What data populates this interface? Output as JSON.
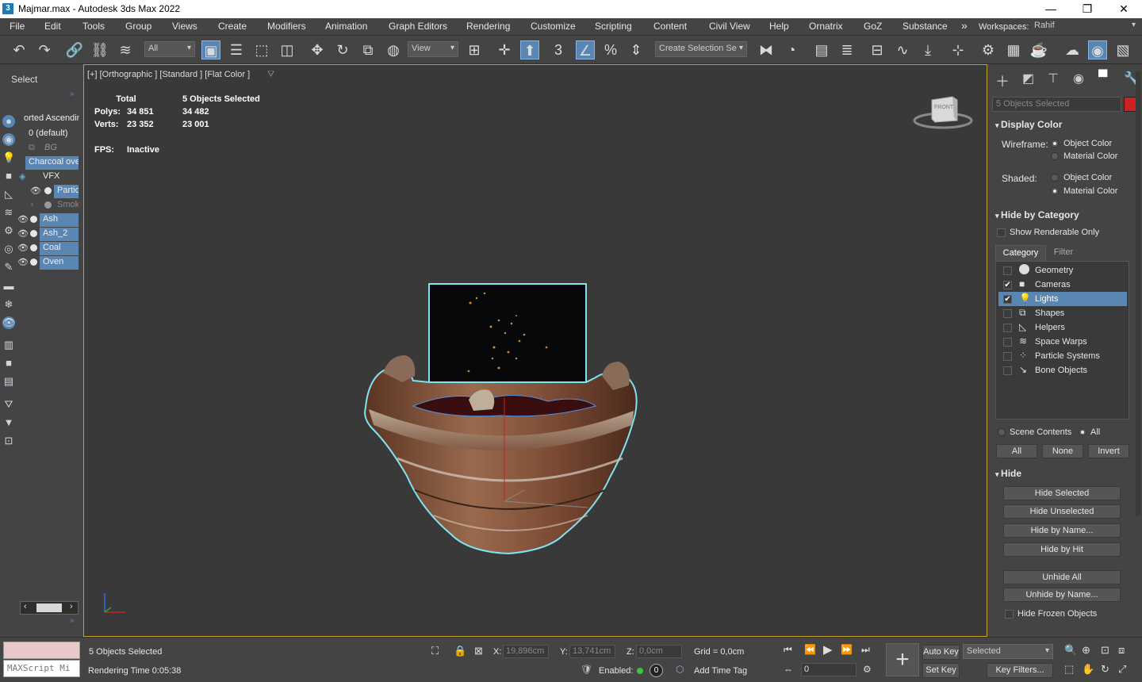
{
  "window": {
    "title": "Majmar.max - Autodesk 3ds Max 2022",
    "app_icon": "3"
  },
  "menubar": {
    "items": [
      "File",
      "Edit",
      "Tools",
      "Group",
      "Views",
      "Create",
      "Modifiers",
      "Animation",
      "Graph Editors",
      "Rendering",
      "Customize",
      "Scripting",
      "Content",
      "Civil View",
      "Help",
      "Ornatrix",
      "GoZ",
      "Substance"
    ],
    "workspaces_label": "Workspaces:",
    "workspace": "Rahif",
    "overflow": "»"
  },
  "toolbar": {
    "filter": "All",
    "ref_coord": "View",
    "selection_set": "Create Selection Se"
  },
  "scene_explorer": {
    "mode_label": "Select",
    "sort_label": "orted Ascendin",
    "items": [
      {
        "name": "0 (default)",
        "selected": false
      },
      {
        "name": "BG",
        "selected": false
      },
      {
        "name": "Charcoal ove",
        "selected": true
      },
      {
        "name": "VFX",
        "selected": false
      },
      {
        "name": "Partic",
        "selected": true
      },
      {
        "name": "Smoke",
        "selected": false
      },
      {
        "name": "Ash",
        "selected": true
      },
      {
        "name": "Ash_2",
        "selected": true
      },
      {
        "name": "Coal",
        "selected": true
      },
      {
        "name": "Oven",
        "selected": true
      }
    ]
  },
  "viewport": {
    "label": "[+] [Orthographic ] [Standard ] [Flat Color ]",
    "viewcube": "FRONT",
    "stats": {
      "col_total": "Total",
      "col_selected": "5 Objects Selected",
      "polys_label": "Polys:",
      "polys_total": "34 851",
      "polys_sel": "34 482",
      "verts_label": "Verts:",
      "verts_total": "23 352",
      "verts_sel": "23 001",
      "fps_label": "FPS:",
      "fps_value": "Inactive"
    }
  },
  "command_panel": {
    "selection_name": "5 Objects Selected",
    "selection_color": "#cc2222",
    "display_color": {
      "title": "Display Color",
      "wireframe_label": "Wireframe:",
      "shaded_label": "Shaded:",
      "object_color": "Object Color",
      "material_color": "Material Color"
    },
    "hide_by_category": {
      "title": "Hide by Category",
      "show_renderable": "Show Renderable Only",
      "tab_category": "Category",
      "tab_filter": "Filter",
      "categories": [
        {
          "name": "Geometry",
          "checked": false
        },
        {
          "name": "Cameras",
          "checked": true
        },
        {
          "name": "Lights",
          "checked": true
        },
        {
          "name": "Shapes",
          "checked": false
        },
        {
          "name": "Helpers",
          "checked": false
        },
        {
          "name": "Space Warps",
          "checked": false
        },
        {
          "name": "Particle Systems",
          "checked": false
        },
        {
          "name": "Bone Objects",
          "checked": false
        }
      ],
      "scene_contents": "Scene Contents",
      "all_radio": "All",
      "btn_all": "All",
      "btn_none": "None",
      "btn_invert": "Invert"
    },
    "hide": {
      "title": "Hide",
      "hide_selected": "Hide Selected",
      "hide_unselected": "Hide Unselected",
      "hide_by_name": "Hide by Name...",
      "hide_by_hit": "Hide by Hit",
      "unhide_all": "Unhide All",
      "unhide_by_name": "Unhide by Name...",
      "hide_frozen": "Hide Frozen Objects"
    }
  },
  "status": {
    "maxscript_placeholder": "MAXScript Mi",
    "selection": "5 Objects Selected",
    "rendering_time": "Rendering Time  0:05:38",
    "x_label": "X:",
    "x_value": "19,896cm",
    "y_label": "Y:",
    "y_value": "13,741cm",
    "z_label": "Z:",
    "z_value": "0,0cm",
    "grid": "Grid = 0,0cm",
    "enabled_label": "Enabled:",
    "add_time_tag": "Add Time Tag",
    "frame": "0",
    "auto_key": "Auto Key",
    "set_key": "Set Key",
    "key_mode": "Selected",
    "key_filters": "Key Filters..."
  }
}
